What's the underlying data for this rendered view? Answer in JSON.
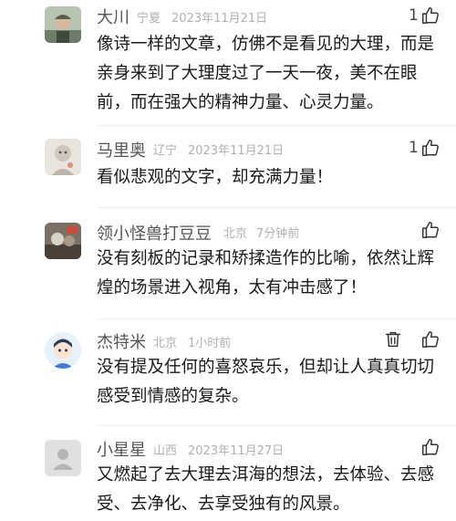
{
  "comments": [
    {
      "username": "大川",
      "location": "宁夏",
      "time": "2023年11月21日",
      "likes": "1",
      "text": "像诗一样的文章，仿佛不是看见的大理，而是亲身来到了大理度过了一天一夜，美不在眼前，而在强大的精神力量、心灵力量。",
      "action_icon": "thumbs-up-icon"
    },
    {
      "username": "马里奥",
      "location": "辽宁",
      "time": "2023年11月21日",
      "likes": "1",
      "text": "看似悲观的文字，却充满力量！",
      "action_icon": "thumbs-up-icon"
    },
    {
      "username": "领小怪兽打豆豆",
      "location": "北京",
      "time": "7分钟前",
      "likes": "",
      "text": "没有刻板的记录和矫揉造作的比喻，依然让辉煌的场景进入视角，太有冲击感了！",
      "action_icon": "thumbs-up-icon"
    },
    {
      "username": "杰特米",
      "location": "北京",
      "time": "1小时前",
      "likes": "",
      "text": "没有提及任何的喜怒哀乐，但却让人真真切切感受到情感的复杂。",
      "action_icon": "trash-icon"
    },
    {
      "username": "小星星",
      "location": "山西",
      "time": "2023年11月27日",
      "likes": "",
      "text": "又燃起了去大理去洱海的想法，去体验、去感受、去净化、去享受独有的风景。",
      "action_icon": "thumbs-up-icon"
    }
  ]
}
